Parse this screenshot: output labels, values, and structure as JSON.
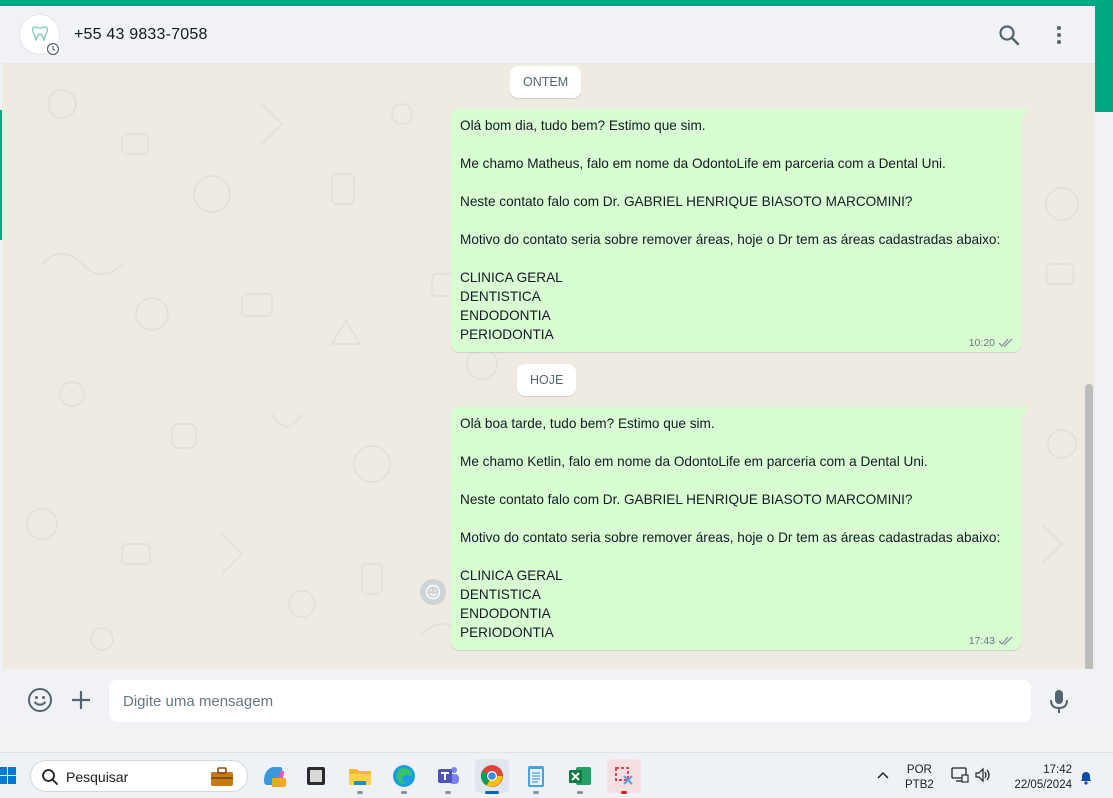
{
  "colors": {
    "accent": "#00a884",
    "bubble_out": "#d9fdd3",
    "chat_bg": "#efeae2",
    "tick_read": "#53bdeb"
  },
  "header": {
    "contact_name": "+55 43 9833-7058",
    "avatar_icon": "tooth-logo-icon",
    "icons": [
      "search-icon",
      "menu-dots-icon"
    ]
  },
  "chat": {
    "date_yesterday": "ONTEM",
    "date_today": "HOJE",
    "messages": [
      {
        "lines": [
          "Olá bom dia, tudo bem? Estimo que sim.",
          "",
          "Me chamo Matheus, falo em nome da OdontoLife em parceria com a Dental Uni.",
          "",
          "Neste contato falo com Dr. GABRIEL HENRIQUE BIASOTO MARCOMINI?",
          "",
          "Motivo do contato seria sobre remover áreas, hoje o Dr tem as áreas cadastradas abaixo:",
          "",
          "CLINICA GERAL",
          "DENTISTICA",
          "ENDODONTIA",
          "PERIODONTIA"
        ],
        "time": "10:20",
        "status": "double-tick-icon"
      },
      {
        "lines": [
          "Olá boa tarde, tudo bem? Estimo que sim.",
          "",
          "Me chamo Ketlin, falo em nome da OdontoLife em parceria com a Dental Uni.",
          "",
          "Neste contato falo com Dr. GABRIEL HENRIQUE BIASOTO MARCOMINI?",
          "",
          "Motivo do contato seria sobre remover áreas, hoje o Dr tem as áreas cadastradas abaixo:",
          "",
          "CLINICA GERAL",
          "DENTISTICA",
          "ENDODONTIA",
          "PERIODONTIA"
        ],
        "time": "17:43",
        "status": "double-tick-icon"
      }
    ]
  },
  "composer": {
    "placeholder": "Digite uma mensagem",
    "icons": [
      "emoji-icon",
      "plus-attach-icon",
      "microphone-icon"
    ]
  },
  "taskbar": {
    "search_label": "Pesquisar",
    "apps": [
      "copilot-icon",
      "terminal-icon",
      "file-explorer-icon",
      "edge-icon",
      "teams-icon",
      "chrome-icon",
      "notepad-icon",
      "excel-icon",
      "snipping-tool-icon"
    ],
    "lang_line1": "POR",
    "lang_line2": "PTB2",
    "time": "17:42",
    "date": "22/05/2024"
  }
}
